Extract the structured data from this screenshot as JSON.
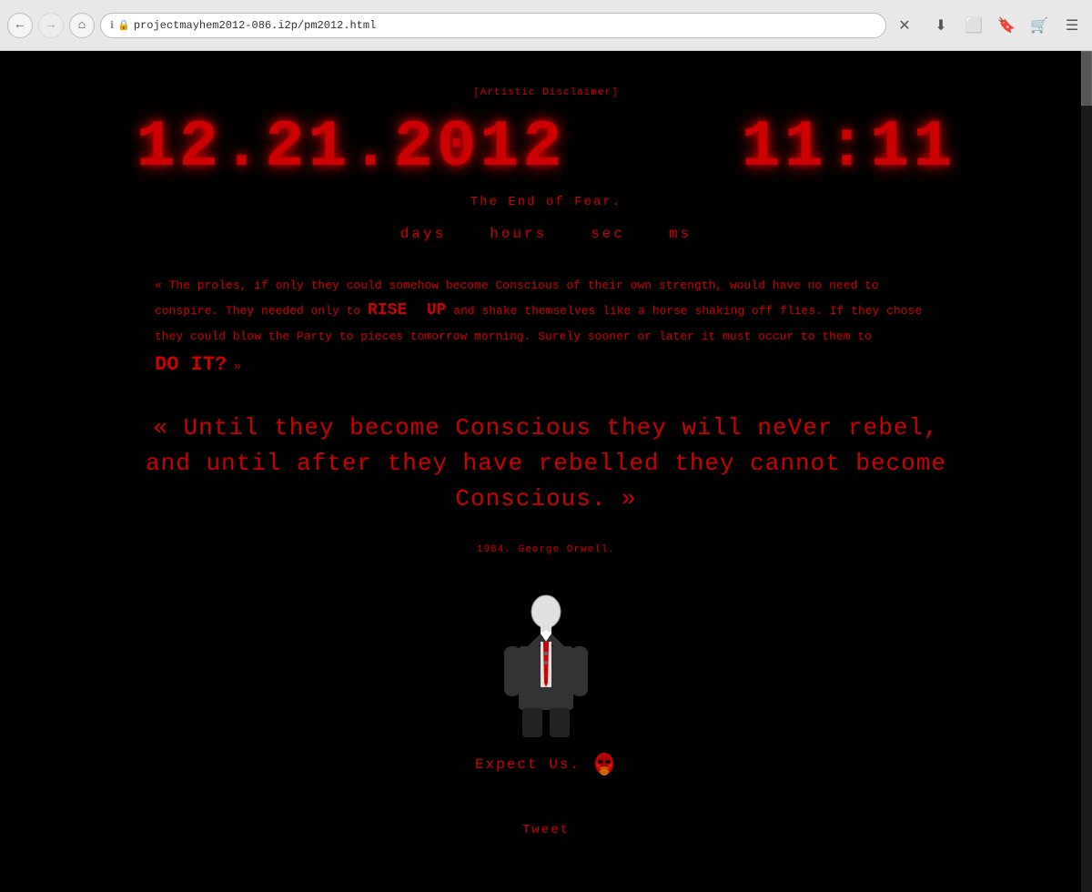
{
  "browser": {
    "url": "projectmayhem2012-086.i2p/pm2012.html",
    "back_disabled": false,
    "forward_disabled": true,
    "nav_icons": [
      "←",
      "→",
      "ℹ",
      "🔒"
    ],
    "action_icons": [
      "⬇",
      "⬜",
      "🔖",
      "🛒",
      "☰"
    ]
  },
  "page": {
    "artistic_disclaimer": "[Artistic Disclaimer]",
    "clock": {
      "date": "12.21.2012",
      "time": "11:11",
      "full_display": "12.21.2012  11:11"
    },
    "subtitle": "The End of Fear.",
    "countdown_labels": [
      "days",
      "hours",
      "sec",
      "ms"
    ],
    "quote_paragraph": "« The proles, if only they could somehow become Conscious of their own strength, would have no need to conspire. They needed only to RISE UP and shake themselves like a horse shaking off flies. If they chose they could blow the Party to pieces tomorrow morning. Surely sooner or later it must occur to them to DO IT? »",
    "large_quote_line1": "« Until they become Conscious they will neVer rebel,",
    "large_quote_line2": "and until after they have rebelled they cannot become Conscious. »",
    "attribution": "1984. George Orwell.",
    "expect_us": "Expect Us.",
    "tweet": "Tweet"
  }
}
